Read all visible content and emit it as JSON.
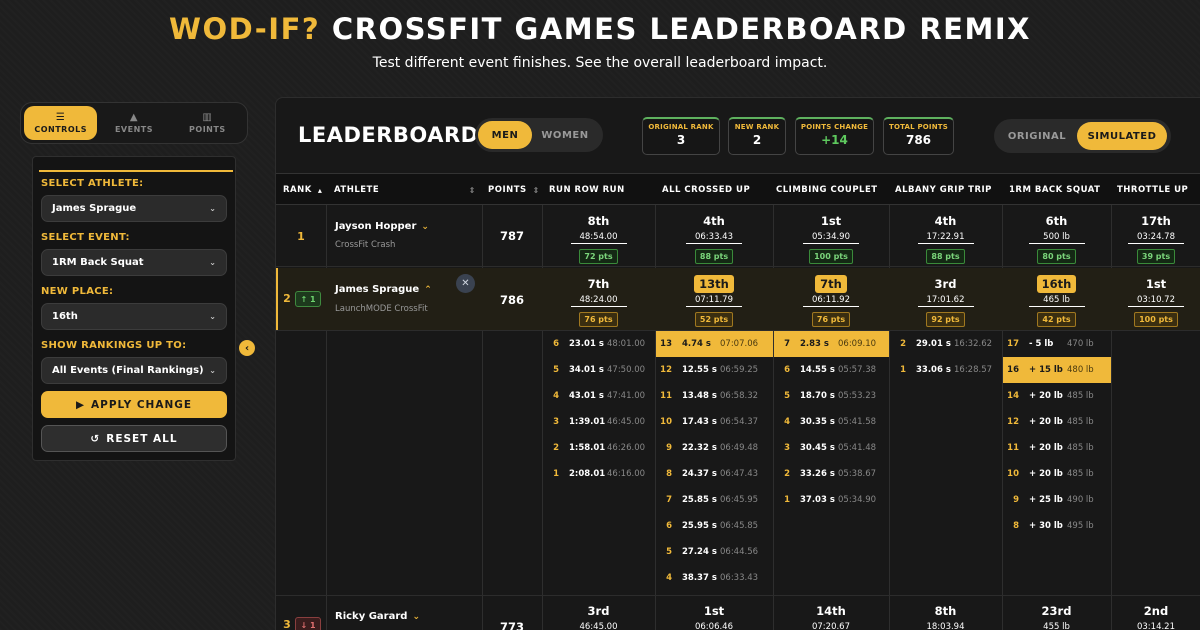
{
  "header": {
    "title_accent": "WOD-IF?",
    "title_rest": "CROSSFIT GAMES LEADERBOARD REMIX",
    "subtitle": "Test different event finishes. See the overall leaderboard impact."
  },
  "sidebar_tabs": [
    {
      "label": "CONTROLS",
      "icon": "sliders-icon",
      "active": true
    },
    {
      "label": "EVENTS",
      "icon": "kettlebell-icon",
      "active": false
    },
    {
      "label": "POINTS",
      "icon": "bar-chart-icon",
      "active": false
    }
  ],
  "controls": {
    "athlete_label": "SELECT ATHLETE:",
    "athlete_value": "James Sprague",
    "event_label": "SELECT EVENT:",
    "event_value": "1RM Back Squat",
    "place_label": "NEW PLACE:",
    "place_value": "16th",
    "rank_label": "SHOW RANKINGS UP TO:",
    "rank_value": "All Events (Final Rankings)",
    "apply": "APPLY CHANGE",
    "reset": "RESET ALL"
  },
  "leaderboard": {
    "title": "LEADERBOARD",
    "gender": {
      "men": "MEN",
      "women": "WOMEN",
      "selected": "MEN"
    },
    "stats": [
      {
        "label": "ORIGINAL RANK",
        "value": "3"
      },
      {
        "label": "NEW RANK",
        "value": "2"
      },
      {
        "label": "POINTS CHANGE",
        "value": "+14"
      },
      {
        "label": "TOTAL POINTS",
        "value": "786"
      }
    ],
    "mode": {
      "original": "ORIGINAL",
      "simulated": "SIMULATED",
      "selected": "SIMULATED"
    },
    "columns": [
      "RANK",
      "ATHLETE",
      "POINTS",
      "RUN ROW RUN",
      "ALL CROSSED UP",
      "CLIMBING COUPLET",
      "ALBANY GRIP TRIP",
      "1RM BACK SQUAT",
      "THROTTLE UP"
    ],
    "rows": [
      {
        "rank": "1",
        "athlete": "Jayson Hopper",
        "affiliate": "CrossFit Crash",
        "points": "787",
        "events": [
          {
            "place": "8th",
            "result": "48:54.00",
            "pts": "72 pts"
          },
          {
            "place": "4th",
            "result": "06:33.43",
            "pts": "88 pts"
          },
          {
            "place": "1st",
            "result": "05:34.90",
            "pts": "100 pts"
          },
          {
            "place": "4th",
            "result": "17:22.91",
            "pts": "88 pts"
          },
          {
            "place": "6th",
            "result": "500 lb",
            "pts": "80 pts"
          },
          {
            "place": "17th",
            "result": "03:24.78",
            "pts": "39 pts"
          }
        ]
      },
      {
        "rank": "2",
        "athlete": "James Sprague",
        "affiliate": "LaunchMODE CrossFit",
        "points": "786",
        "change": "↑ 1",
        "events": [
          {
            "place": "7th",
            "result": "48:24.00",
            "pts": "76 pts"
          },
          {
            "place": "13th",
            "result": "07:11.79",
            "pts": "52 pts",
            "hl": true
          },
          {
            "place": "7th",
            "result": "06:11.92",
            "pts": "76 pts",
            "hl": true
          },
          {
            "place": "3rd",
            "result": "17:01.62",
            "pts": "92 pts"
          },
          {
            "place": "16th",
            "result": "465 lb",
            "pts": "42 pts",
            "hl": true
          },
          {
            "place": "1st",
            "result": "03:10.72",
            "pts": "100 pts"
          }
        ]
      },
      {
        "rank": "3",
        "athlete": "Ricky Garard",
        "affiliate": "",
        "points": "773",
        "change": "↓ 1",
        "events": [
          {
            "place": "3rd",
            "result": "46:45.00"
          },
          {
            "place": "1st",
            "result": "06:06.46"
          },
          {
            "place": "14th",
            "result": "07:20.67"
          },
          {
            "place": "8th",
            "result": "18:03.94"
          },
          {
            "place": "23rd",
            "result": "455 lb"
          },
          {
            "place": "2nd",
            "result": "03:14.21"
          }
        ]
      }
    ],
    "whatif": [
      [
        {
          "p": "6",
          "v": "23.01 s",
          "t": "48:01.00"
        },
        {
          "p": "5",
          "v": "34.01 s",
          "t": "47:50.00"
        },
        {
          "p": "4",
          "v": "43.01 s",
          "t": "47:41.00"
        },
        {
          "p": "3",
          "v": "1:39.01",
          "t": "46:45.00"
        },
        {
          "p": "2",
          "v": "1:58.01",
          "t": "46:26.00"
        },
        {
          "p": "1",
          "v": "2:08.01",
          "t": "46:16.00"
        }
      ],
      [
        {
          "p": "13",
          "v": "4.74 s",
          "t": "07:07.06",
          "hl": true
        },
        {
          "p": "12",
          "v": "12.55 s",
          "t": "06:59.25"
        },
        {
          "p": "11",
          "v": "13.48 s",
          "t": "06:58.32"
        },
        {
          "p": "10",
          "v": "17.43 s",
          "t": "06:54.37"
        },
        {
          "p": "9",
          "v": "22.32 s",
          "t": "06:49.48"
        },
        {
          "p": "8",
          "v": "24.37 s",
          "t": "06:47.43"
        },
        {
          "p": "7",
          "v": "25.85 s",
          "t": "06:45.95"
        },
        {
          "p": "6",
          "v": "25.95 s",
          "t": "06:45.85"
        },
        {
          "p": "5",
          "v": "27.24 s",
          "t": "06:44.56"
        },
        {
          "p": "4",
          "v": "38.37 s",
          "t": "06:33.43"
        }
      ],
      [
        {
          "p": "7",
          "v": "2.83 s",
          "t": "06:09.10",
          "hl": true
        },
        {
          "p": "6",
          "v": "14.55 s",
          "t": "05:57.38"
        },
        {
          "p": "5",
          "v": "18.70 s",
          "t": "05:53.23"
        },
        {
          "p": "4",
          "v": "30.35 s",
          "t": "05:41.58"
        },
        {
          "p": "3",
          "v": "30.45 s",
          "t": "05:41.48"
        },
        {
          "p": "2",
          "v": "33.26 s",
          "t": "05:38.67"
        },
        {
          "p": "1",
          "v": "37.03 s",
          "t": "05:34.90"
        }
      ],
      [
        {
          "p": "2",
          "v": "29.01 s",
          "t": "16:32.62"
        },
        {
          "p": "1",
          "v": "33.06 s",
          "t": "16:28.57"
        }
      ],
      [
        {
          "p": "17",
          "v": "- 5 lb",
          "t": "470 lb"
        },
        {
          "p": "16",
          "v": "+ 15 lb",
          "t": "480 lb",
          "hl": true
        },
        {
          "p": "14",
          "v": "+ 20 lb",
          "t": "485 lb"
        },
        {
          "p": "12",
          "v": "+ 20 lb",
          "t": "485 lb"
        },
        {
          "p": "11",
          "v": "+ 20 lb",
          "t": "485 lb"
        },
        {
          "p": "10",
          "v": "+ 20 lb",
          "t": "485 lb"
        },
        {
          "p": "9",
          "v": "+ 25 lb",
          "t": "490 lb"
        },
        {
          "p": "8",
          "v": "+ 30 lb",
          "t": "495 lb"
        }
      ],
      []
    ]
  },
  "colors": {
    "accent": "#f0b93a",
    "up": "#6fd46f",
    "down": "#e07070",
    "bg": "#1e1e1e"
  }
}
